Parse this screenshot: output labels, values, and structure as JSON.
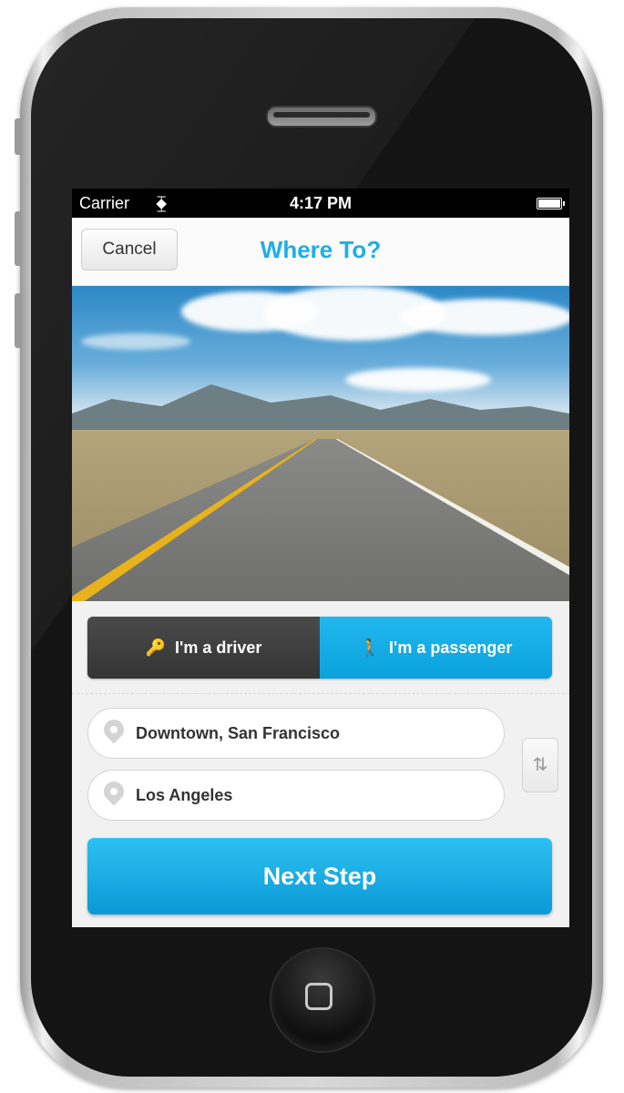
{
  "statusbar": {
    "carrier": "Carrier",
    "time": "4:17 PM"
  },
  "navbar": {
    "cancel_label": "Cancel",
    "title": "Where To?"
  },
  "role_toggle": {
    "driver_label": "I'm a driver",
    "passenger_label": "I'm a passenger",
    "selected": "passenger"
  },
  "route": {
    "origin": "Downtown, San Francisco",
    "destination": "Los Angeles",
    "swap_symbol": "⇅"
  },
  "next_button_label": "Next Step",
  "colors": {
    "accent": "#1eaee6",
    "toggle_inactive": "#3a3a3a",
    "toggle_active": "#12abe6",
    "next_button": "#15aee8"
  },
  "icons": {
    "driver": "driver-icon",
    "passenger": "passenger-icon",
    "pin": "location-pin-icon",
    "swap": "swap-icon",
    "wifi": "wifi-icon",
    "battery": "battery-icon"
  }
}
